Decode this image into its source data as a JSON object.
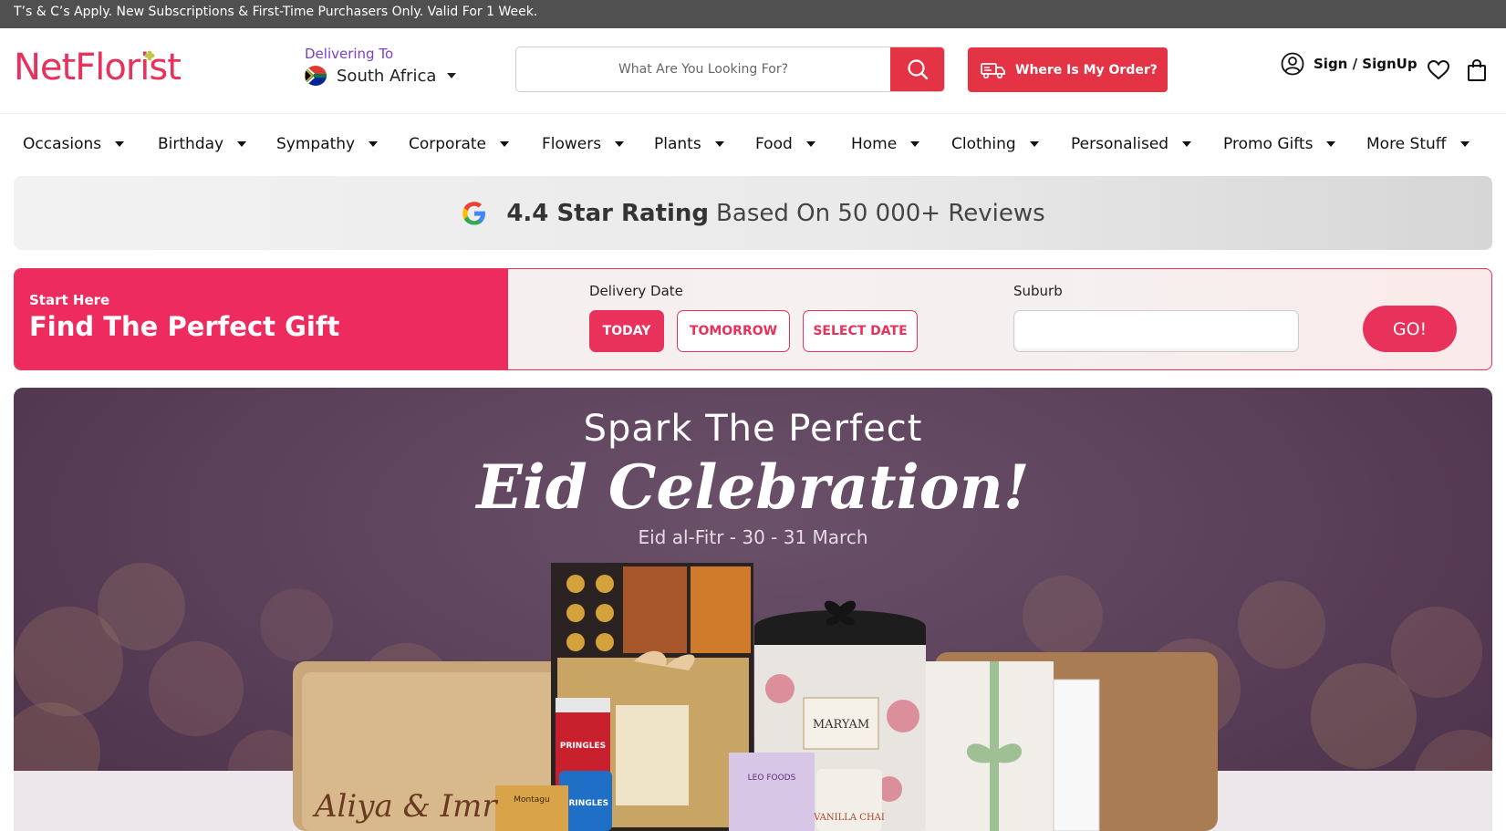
{
  "promo_strip": {
    "text": "T’s & C’s Apply. New Subscriptions & First-Time Purchasers Only. Valid For 1 Week."
  },
  "header": {
    "logo_text": "NetFlorist",
    "delivering_label": "Delivering To",
    "country": "South Africa",
    "search_placeholder": "What Are You Looking For?",
    "order_button": "Where Is My Order?",
    "account_label": "Sign / SignUp"
  },
  "nav": {
    "items": [
      {
        "label": "Occasions"
      },
      {
        "label": "Birthday"
      },
      {
        "label": "Sympathy"
      },
      {
        "label": "Corporate"
      },
      {
        "label": "Flowers"
      },
      {
        "label": "Plants"
      },
      {
        "label": "Food"
      },
      {
        "label": "Home"
      },
      {
        "label": "Clothing"
      },
      {
        "label": "Personalised"
      },
      {
        "label": "Promo Gifts"
      },
      {
        "label": "More Stuff"
      }
    ]
  },
  "rating": {
    "strong": "4.4 Star Rating",
    "rest": "Based On 50 000+ Reviews"
  },
  "finder": {
    "subtitle": "Start Here",
    "title": "Find The Perfect Gift",
    "date_label": "Delivery Date",
    "date_options": [
      "TODAY",
      "TOMORROW",
      "SELECT DATE"
    ],
    "selected_date": "TODAY",
    "suburb_label": "Suburb",
    "suburb_value": "",
    "go_button": "GO!"
  },
  "hero": {
    "line1": "Spark The Perfect",
    "line2": "Eid Celebration!",
    "dates": "Eid al-Fitr - 30 - 31 March",
    "board_text": "Aliya & Imr",
    "product_labels": [
      "PRINGLES",
      "PRINGLES",
      "MARYAM",
      "LEO FOODS",
      "VANILLA CHAI",
      "Montagu"
    ]
  },
  "colors": {
    "brand": "#e8315b",
    "accent_red": "#e43344",
    "promo_strip": "#505050",
    "hero_bg": "#5a3f58"
  }
}
